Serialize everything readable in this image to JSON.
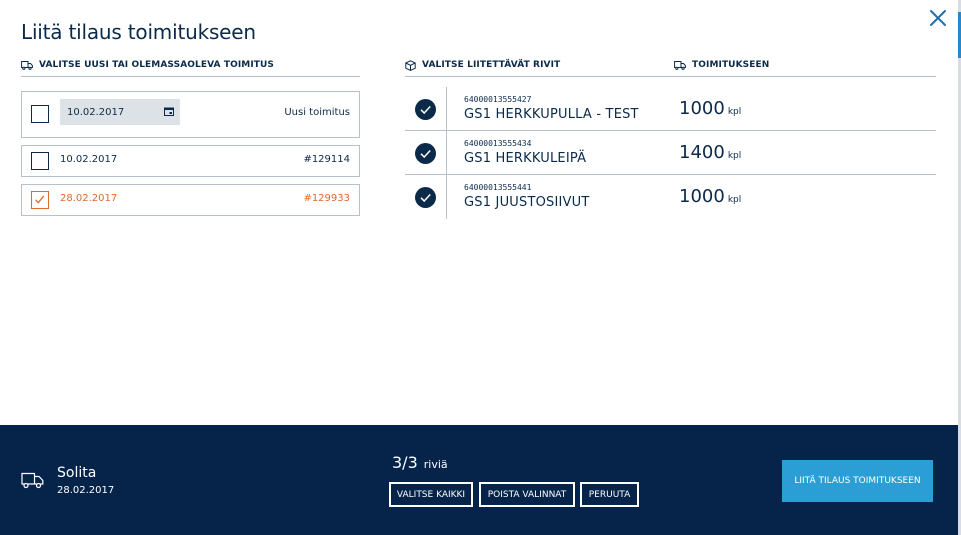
{
  "modal": {
    "title": "Liitä tilaus toimitukseen"
  },
  "left_panel": {
    "header": "VALITSE UUSI TAI OLEMASSAOLEVA TOIMITUS",
    "new_delivery": {
      "date_value": "10.02.2017",
      "label": "Uusi toimitus",
      "checked": false
    },
    "deliveries": [
      {
        "date": "10.02.2017",
        "number": "#129114",
        "checked": false
      },
      {
        "date": "28.02.2017",
        "number": "#129933",
        "checked": true
      }
    ]
  },
  "right_panel": {
    "rows_header": "VALITSE LIITETTÄVÄT RIVIT",
    "delivery_header": "TOIMITUKSEEN",
    "rows": [
      {
        "code": "64000013555427",
        "name": "GS1 HERKKUPULLA - TEST",
        "qty": "1000",
        "unit": "kpl",
        "checked": true
      },
      {
        "code": "64000013555434",
        "name": "GS1 HERKKULEIPÄ",
        "qty": "1400",
        "unit": "kpl",
        "checked": true
      },
      {
        "code": "64000013555441",
        "name": "GS1 JUUSTOSIIVUT",
        "qty": "1000",
        "unit": "kpl",
        "checked": true
      }
    ]
  },
  "footer": {
    "supplier": "Solita",
    "date": "28.02.2017",
    "count": "3/3",
    "count_label": "riviä",
    "select_all": "VALITSE KAIKKI",
    "clear_selection": "POISTA VALINNAT",
    "cancel": "PERUUTA",
    "submit": "LIITÄ TILAUS TOIMITUKSEEN"
  },
  "icons": {
    "close": "close-icon",
    "truck": "truck-icon",
    "box": "box-icon",
    "calendar": "calendar-icon",
    "check": "check-icon"
  },
  "colors": {
    "navy": "#0b2a4a",
    "footer": "#06244a",
    "accent_orange": "#e06a2c",
    "primary_button": "#2c9ed6"
  }
}
